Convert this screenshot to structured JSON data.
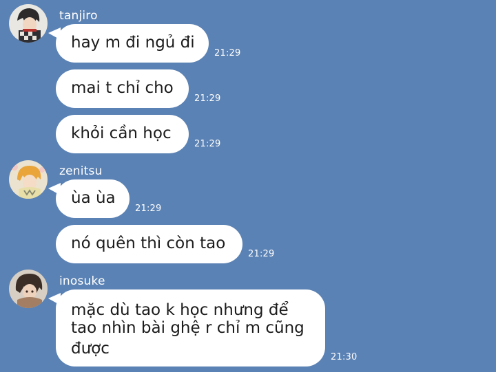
{
  "messages": [
    {
      "sender": "tanjiro",
      "text": "hay m đi ngủ đi",
      "time": "21:29"
    },
    {
      "sender": "tanjiro",
      "text": "mai t chỉ cho",
      "time": "21:29"
    },
    {
      "sender": "tanjiro",
      "text": "khỏi cần học",
      "time": "21:29"
    },
    {
      "sender": "zenitsu",
      "text": "ùa ùa",
      "time": "21:29"
    },
    {
      "sender": "zenitsu",
      "text": "nó quên thì còn tao",
      "time": "21:29"
    },
    {
      "sender": "inosuke",
      "lines": [
        "mặc dù tao k học nhưng để",
        "tao nhìn bài ghệ r chỉ m cũng",
        "được"
      ],
      "time": "21:30"
    }
  ],
  "colors": {
    "background": "#5b82b4",
    "bubble": "#ffffff",
    "message_text": "#1c1c1c",
    "meta_text": "#ffffff"
  }
}
